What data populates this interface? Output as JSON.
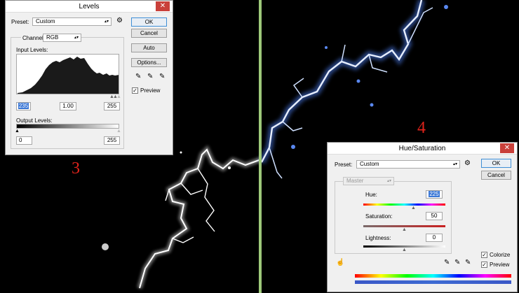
{
  "canvas": {
    "left_step_number": "3",
    "right_step_number": "4"
  },
  "levels": {
    "title": "Levels",
    "close_glyph": "✕",
    "preset_label": "Preset:",
    "preset_value": "Custom",
    "channel_label": "Channel:",
    "channel_value": "RGB",
    "input_levels_label": "Input Levels:",
    "input_black": "235",
    "input_gamma": "1.00",
    "input_white": "255",
    "output_levels_label": "Output Levels:",
    "output_black": "0",
    "output_white": "255",
    "ok_label": "OK",
    "cancel_label": "Cancel",
    "auto_label": "Auto",
    "options_label": "Options...",
    "preview_label": "Preview",
    "preview_checked": "✓"
  },
  "hue_saturation": {
    "title": "Hue/Saturation",
    "close_glyph": "✕",
    "preset_label": "Preset:",
    "preset_value": "Custom",
    "range_value": "Master",
    "hue_label": "Hue:",
    "hue_value": "225",
    "saturation_label": "Saturation:",
    "saturation_value": "50",
    "lightness_label": "Lightness:",
    "lightness_value": "0",
    "ok_label": "OK",
    "cancel_label": "Cancel",
    "colorize_label": "Colorize",
    "colorize_checked": "✓",
    "preview_label": "Preview",
    "preview_checked": "✓"
  },
  "colors": {
    "background": "#000000",
    "divider": "#9ec97a",
    "step_number": "#e0231b",
    "close_button": "#c9403a",
    "selection": "#3a77d6"
  }
}
